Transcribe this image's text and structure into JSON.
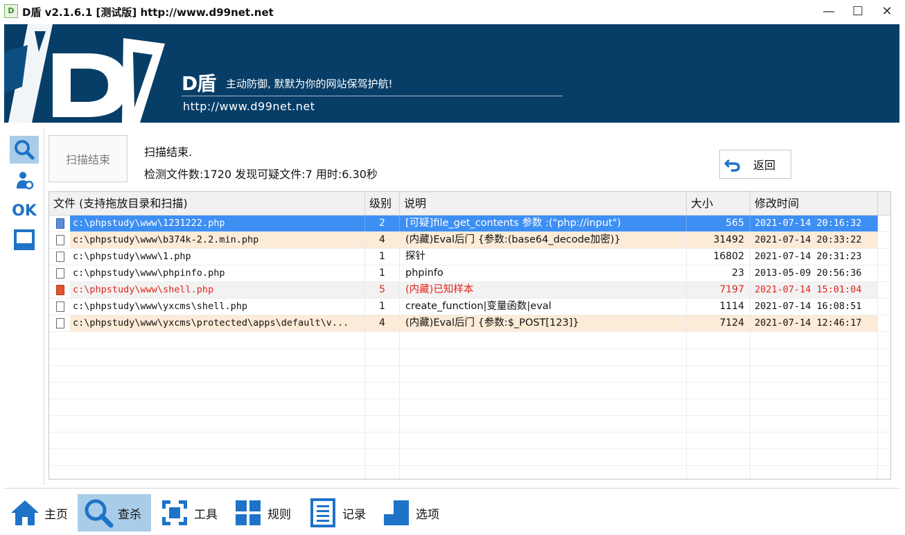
{
  "window": {
    "title": "D盾 v2.1.6.1 [测试版] http://www.d99net.net",
    "icon_text": "D",
    "controls": {
      "minimize": "—",
      "maximize": "☐",
      "close": "✕"
    }
  },
  "banner": {
    "brand": "D盾",
    "slogan": "主动防御, 默默为你的网站保驾护航!",
    "url": "http://www.d99net.net"
  },
  "status": {
    "scan_end_button": "扫描结束",
    "line1": "扫描结束.",
    "line2": "检测文件数:1720 发现可疑文件:7 用时:6.30秒",
    "back_button": "返回"
  },
  "table": {
    "columns": [
      "文件 (支持拖放目录和扫描)",
      "级别",
      "说明",
      "大小",
      "修改时间"
    ],
    "rows": [
      {
        "file": "c:\\phpstudy\\www\\1231222.php",
        "level": "2",
        "desc": "[可疑]file_get_contents 参数 :(\"php://input\")",
        "size": "565",
        "time": "2021-07-14 20:16:32",
        "state": "selected"
      },
      {
        "file": "c:\\phpstudy\\www\\b374k-2.2.min.php",
        "level": "4",
        "desc": "(内藏)Eval后门 {参数:(base64_decode加密)}",
        "size": "31492",
        "time": "2021-07-14 20:33:22",
        "state": "warn"
      },
      {
        "file": "c:\\phpstudy\\www\\1.php",
        "level": "1",
        "desc": "探针",
        "size": "16802",
        "time": "2021-07-14 20:31:23",
        "state": "normal"
      },
      {
        "file": "c:\\phpstudy\\www\\phpinfo.php",
        "level": "1",
        "desc": "phpinfo",
        "size": "23",
        "time": "2013-05-09 20:56:36",
        "state": "normal"
      },
      {
        "file": "c:\\phpstudy\\www\\shell.php",
        "level": "5",
        "desc": "(内藏)已知样本",
        "size": "7197",
        "time": "2021-07-14 15:01:04",
        "state": "danger"
      },
      {
        "file": "c:\\phpstudy\\www\\yxcms\\shell.php",
        "level": "1",
        "desc": "create_function|变量函数|eval",
        "size": "1114",
        "time": "2021-07-14 16:08:51",
        "state": "normal"
      },
      {
        "file": "c:\\phpstudy\\www\\yxcms\\protected\\apps\\default\\v...",
        "level": "4",
        "desc": "(内藏)Eval后门 {参数:$_POST[123]}",
        "size": "7124",
        "time": "2021-07-14 12:46:17",
        "state": "warn"
      }
    ]
  },
  "sidebar": {
    "ok_label": "OK"
  },
  "nav": {
    "items": [
      {
        "label": "主页",
        "icon": "home-icon"
      },
      {
        "label": "查杀",
        "icon": "search-icon"
      },
      {
        "label": "工具",
        "icon": "tools-icon"
      },
      {
        "label": "规则",
        "icon": "rules-icon"
      },
      {
        "label": "记录",
        "icon": "log-icon"
      },
      {
        "label": "选项",
        "icon": "options-icon"
      }
    ],
    "active": "查杀"
  },
  "colors": {
    "banner": "#073e68",
    "selected_row": "#3e8ff4",
    "warn_row": "#fcebd6",
    "danger_text": "#e0261c",
    "nav_active": "#a9cde9",
    "icon_blue": "#1e73c8"
  }
}
